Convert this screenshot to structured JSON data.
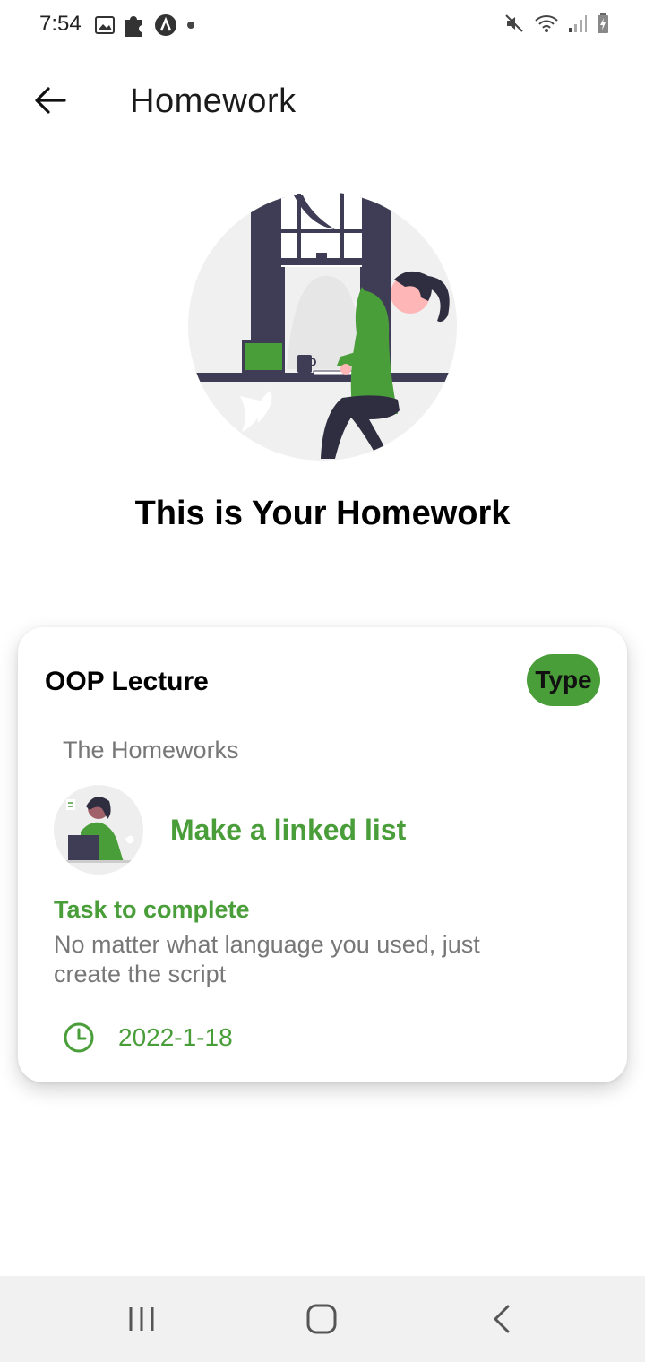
{
  "status_bar": {
    "time": "7:54",
    "left_icons": [
      "image-icon",
      "puzzle-icon",
      "app-icon",
      "dot-icon"
    ],
    "right_icons": [
      "mute-icon",
      "wifi-icon",
      "signal-icon",
      "battery-icon"
    ]
  },
  "app_bar": {
    "title": "Homework",
    "back_icon": "arrow-left-icon"
  },
  "headline": "This is Your Homework",
  "card": {
    "title": "OOP Lecture",
    "badge": "Type",
    "section_label": "The Homeworks",
    "homework_name": "Make a linked list",
    "task_label": "Task to complete",
    "task_description": "No matter what language you used, just create the script",
    "due_date": "2022-1-18",
    "due_icon": "clock-icon"
  },
  "colors": {
    "accent": "#4a9e3a",
    "dark": "#3f3d56",
    "muted": "#777777"
  },
  "nav_bar": {
    "buttons": [
      "recent-apps-icon",
      "home-icon",
      "back-icon"
    ]
  }
}
